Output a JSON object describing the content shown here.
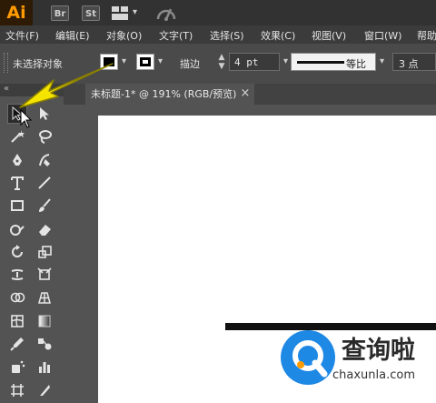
{
  "app": {
    "logo": "Ai",
    "bridge_label": "Br",
    "stock_label": "St",
    "brand_color": "#FF9A00"
  },
  "menu": {
    "items": [
      "文件(F)",
      "编辑(E)",
      "对象(O)",
      "文字(T)",
      "选择(S)",
      "效果(C)",
      "视图(V)",
      "窗口(W)",
      "帮助"
    ]
  },
  "control": {
    "selection_status": "未选择对象",
    "stroke_label": "描边",
    "stroke_weight": "4 pt",
    "stroke_profile": "等比",
    "brush_size": "3 点"
  },
  "tab": {
    "title": "未标题-1* @ 191% (RGB/预览)",
    "close": "×"
  },
  "tools": {
    "icons": [
      "selection-tool-icon",
      "direct-selection-tool-icon",
      "magic-wand-tool-icon",
      "lasso-tool-icon",
      "pen-tool-icon",
      "curvature-tool-icon",
      "type-tool-icon",
      "line-segment-tool-icon",
      "rectangle-tool-icon",
      "paintbrush-tool-icon",
      "shaper-tool-icon",
      "eraser-tool-icon",
      "rotate-tool-icon",
      "scale-tool-icon",
      "width-tool-icon",
      "free-transform-tool-icon",
      "shape-builder-tool-icon",
      "perspective-grid-tool-icon",
      "mesh-tool-icon",
      "gradient-tool-icon",
      "eyedropper-tool-icon",
      "blend-tool-icon",
      "symbol-sprayer-tool-icon",
      "column-graph-tool-icon",
      "artboard-tool-icon",
      "slice-tool-icon"
    ],
    "selected": "selection-tool-icon"
  },
  "watermark": {
    "title": "查询啦",
    "domain": "chaxunla.com",
    "color": "#1E88E5"
  },
  "annotation": {
    "pointer_color": "#F5E400"
  }
}
